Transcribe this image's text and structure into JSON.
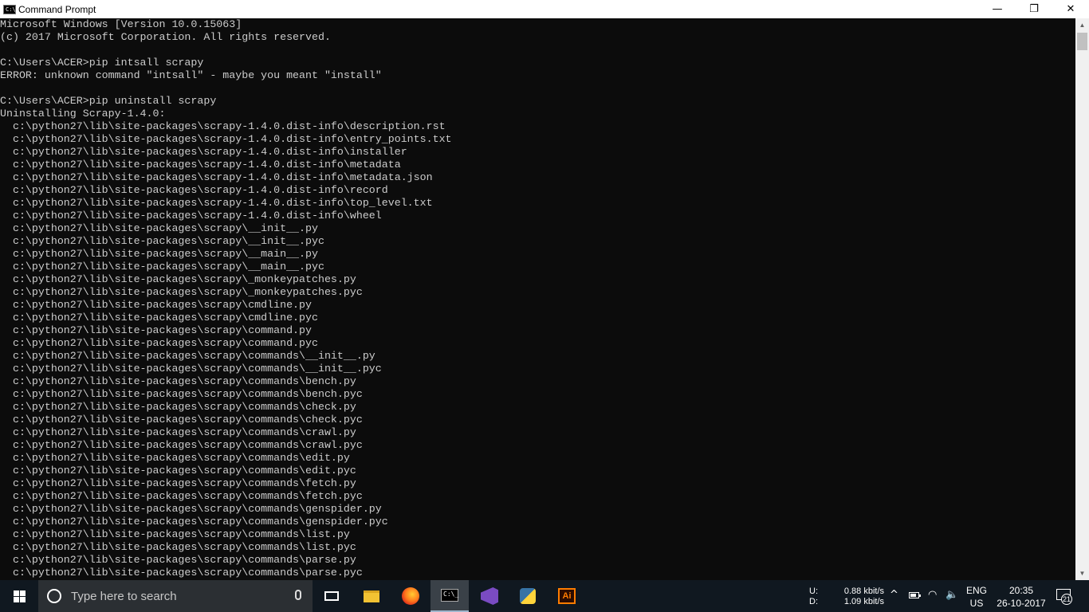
{
  "window": {
    "title": "Command Prompt",
    "icon_text": "C:\\_",
    "controls": {
      "minimize": "—",
      "maximize": "❐",
      "close": "✕"
    }
  },
  "console": {
    "lines": [
      "Microsoft Windows [Version 10.0.15063]",
      "(c) 2017 Microsoft Corporation. All rights reserved.",
      "",
      "C:\\Users\\ACER>pip intsall scrapy",
      "ERROR: unknown command \"intsall\" - maybe you meant \"install\"",
      "",
      "C:\\Users\\ACER>pip uninstall scrapy",
      "Uninstalling Scrapy-1.4.0:",
      "  c:\\python27\\lib\\site-packages\\scrapy-1.4.0.dist-info\\description.rst",
      "  c:\\python27\\lib\\site-packages\\scrapy-1.4.0.dist-info\\entry_points.txt",
      "  c:\\python27\\lib\\site-packages\\scrapy-1.4.0.dist-info\\installer",
      "  c:\\python27\\lib\\site-packages\\scrapy-1.4.0.dist-info\\metadata",
      "  c:\\python27\\lib\\site-packages\\scrapy-1.4.0.dist-info\\metadata.json",
      "  c:\\python27\\lib\\site-packages\\scrapy-1.4.0.dist-info\\record",
      "  c:\\python27\\lib\\site-packages\\scrapy-1.4.0.dist-info\\top_level.txt",
      "  c:\\python27\\lib\\site-packages\\scrapy-1.4.0.dist-info\\wheel",
      "  c:\\python27\\lib\\site-packages\\scrapy\\__init__.py",
      "  c:\\python27\\lib\\site-packages\\scrapy\\__init__.pyc",
      "  c:\\python27\\lib\\site-packages\\scrapy\\__main__.py",
      "  c:\\python27\\lib\\site-packages\\scrapy\\__main__.pyc",
      "  c:\\python27\\lib\\site-packages\\scrapy\\_monkeypatches.py",
      "  c:\\python27\\lib\\site-packages\\scrapy\\_monkeypatches.pyc",
      "  c:\\python27\\lib\\site-packages\\scrapy\\cmdline.py",
      "  c:\\python27\\lib\\site-packages\\scrapy\\cmdline.pyc",
      "  c:\\python27\\lib\\site-packages\\scrapy\\command.py",
      "  c:\\python27\\lib\\site-packages\\scrapy\\command.pyc",
      "  c:\\python27\\lib\\site-packages\\scrapy\\commands\\__init__.py",
      "  c:\\python27\\lib\\site-packages\\scrapy\\commands\\__init__.pyc",
      "  c:\\python27\\lib\\site-packages\\scrapy\\commands\\bench.py",
      "  c:\\python27\\lib\\site-packages\\scrapy\\commands\\bench.pyc",
      "  c:\\python27\\lib\\site-packages\\scrapy\\commands\\check.py",
      "  c:\\python27\\lib\\site-packages\\scrapy\\commands\\check.pyc",
      "  c:\\python27\\lib\\site-packages\\scrapy\\commands\\crawl.py",
      "  c:\\python27\\lib\\site-packages\\scrapy\\commands\\crawl.pyc",
      "  c:\\python27\\lib\\site-packages\\scrapy\\commands\\edit.py",
      "  c:\\python27\\lib\\site-packages\\scrapy\\commands\\edit.pyc",
      "  c:\\python27\\lib\\site-packages\\scrapy\\commands\\fetch.py",
      "  c:\\python27\\lib\\site-packages\\scrapy\\commands\\fetch.pyc",
      "  c:\\python27\\lib\\site-packages\\scrapy\\commands\\genspider.py",
      "  c:\\python27\\lib\\site-packages\\scrapy\\commands\\genspider.pyc",
      "  c:\\python27\\lib\\site-packages\\scrapy\\commands\\list.py",
      "  c:\\python27\\lib\\site-packages\\scrapy\\commands\\list.pyc",
      "  c:\\python27\\lib\\site-packages\\scrapy\\commands\\parse.py",
      "  c:\\python27\\lib\\site-packages\\scrapy\\commands\\parse.pyc"
    ]
  },
  "taskbar": {
    "search_placeholder": "Type here to search",
    "pinned": [
      {
        "name": "task-view-icon",
        "active": false
      },
      {
        "name": "file-explorer-icon",
        "active": false
      },
      {
        "name": "firefox-icon",
        "active": false
      },
      {
        "name": "command-prompt-icon",
        "active": true
      },
      {
        "name": "visual-studio-icon",
        "active": false
      },
      {
        "name": "python-icon",
        "active": false
      },
      {
        "name": "illustrator-icon",
        "active": false
      }
    ],
    "illustrator_label": "Ai",
    "cmd_icon_text": "C:\\_",
    "network": {
      "upload_label": "U:",
      "download_label": "D:",
      "upload_speed": "0.88 kbit/s",
      "download_speed": "1.09 kbit/s"
    },
    "tray_glyphs": {
      "chevron": "^",
      "wifi": "◠",
      "volume": "🔈"
    },
    "language": {
      "code": "ENG",
      "region": "US"
    },
    "clock": {
      "time": "20:35",
      "date": "26-10-2017"
    },
    "notification_count": "21"
  },
  "colors": {
    "console_bg": "#0c0c0c",
    "console_text": "#cccccc",
    "taskbar_bg": "#101820",
    "titlebar_bg": "#ffffff"
  }
}
